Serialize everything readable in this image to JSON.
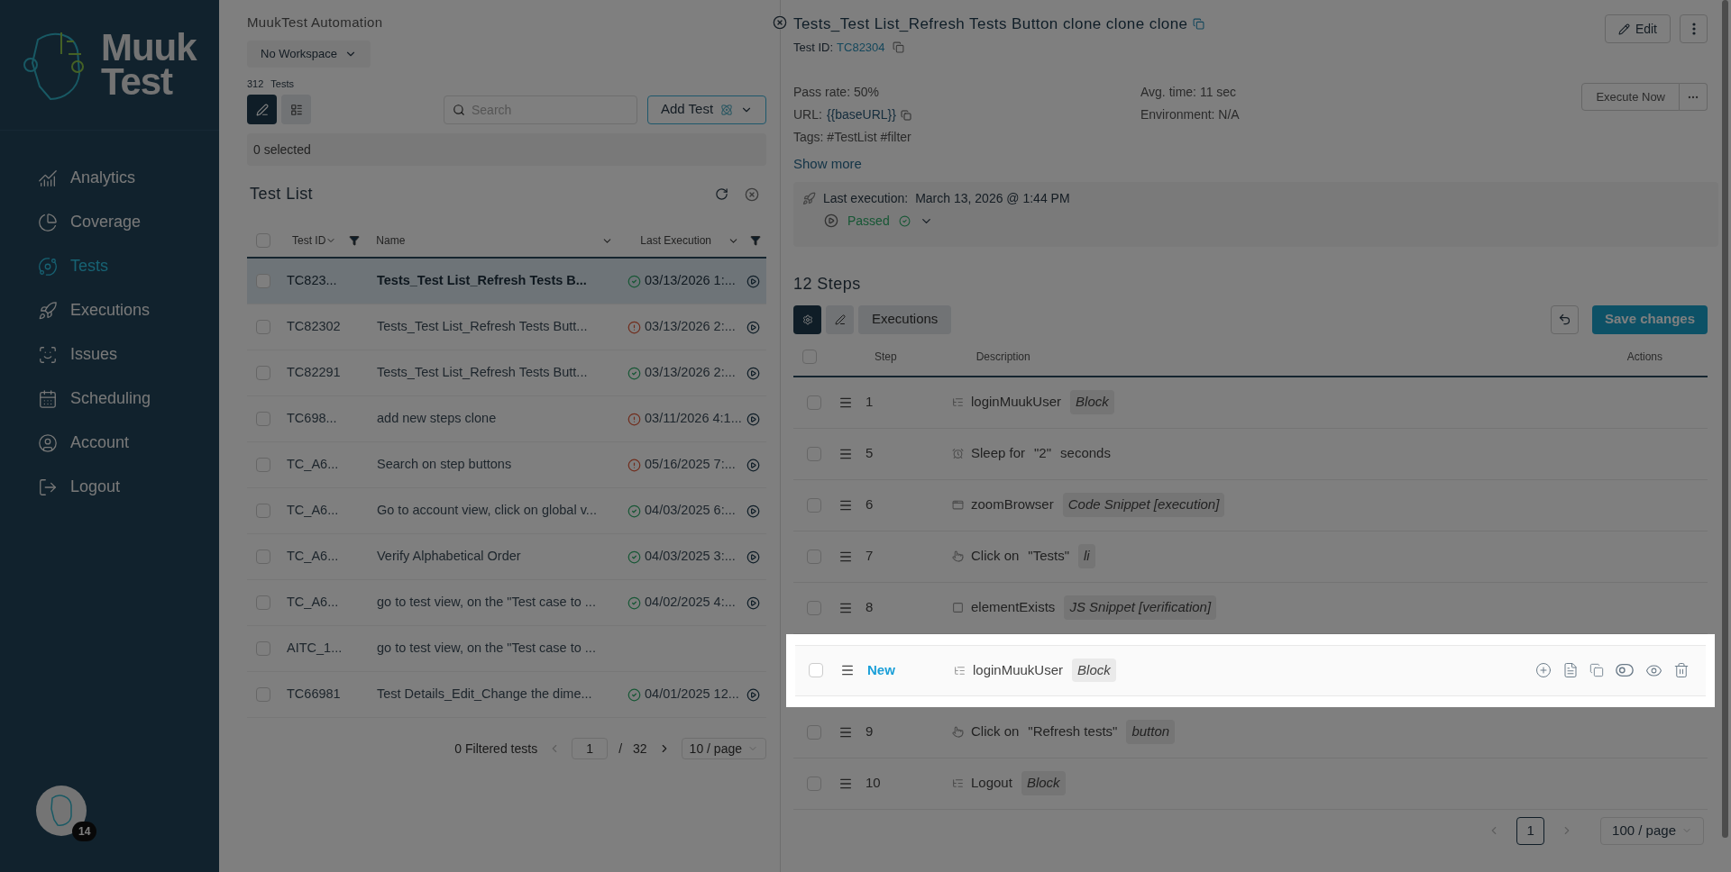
{
  "sidebar": {
    "logo": {
      "line1": "Muuk",
      "line2": "Test"
    },
    "items": [
      {
        "kind": "analytics",
        "label": "Analytics",
        "selected": false
      },
      {
        "kind": "coverage",
        "label": "Coverage",
        "selected": false
      },
      {
        "kind": "tests",
        "label": "Tests",
        "selected": true
      },
      {
        "kind": "executions",
        "label": "Executions",
        "selected": false
      },
      {
        "kind": "issues",
        "label": "Issues",
        "selected": false
      },
      {
        "kind": "scheduling",
        "label": "Scheduling",
        "selected": false
      },
      {
        "kind": "account",
        "label": "Account",
        "selected": false
      },
      {
        "kind": "logout",
        "label": "Logout",
        "selected": false
      }
    ],
    "avatar_badge": "14"
  },
  "workspace": {
    "organization": "MuukTest Automation",
    "workspace": "No Workspace"
  },
  "tests": {
    "count": "312",
    "count_label": "Tests",
    "views": [
      {
        "kind": "edit",
        "selected": true
      },
      {
        "kind": "list",
        "selected": false
      }
    ],
    "search_placeholder": "Search",
    "add_button": "Add Test",
    "selected_count": "0 selected",
    "list_title": "Test List",
    "all_checked": false,
    "columns": [
      "Test ID",
      "Name",
      "Last Execution"
    ],
    "rows": [
      {
        "id": "TC823...",
        "name": "Tests_Test List_Refresh Tests B...",
        "kind": "passed",
        "last_execution": "03/13/2026 1:...",
        "selected": true,
        "checked": false
      },
      {
        "id": "TC82302",
        "name": "Tests_Test List_Refresh Tests Butt...",
        "kind": "failed",
        "last_execution": "03/13/2026 2:...",
        "selected": false,
        "checked": false
      },
      {
        "id": "TC82291",
        "name": "Tests_Test List_Refresh Tests Butt...",
        "kind": "passed",
        "last_execution": "03/13/2026 2:...",
        "selected": false,
        "checked": false
      },
      {
        "id": "TC698...",
        "name": "add new steps clone",
        "kind": "failed",
        "last_execution": "03/11/2026 4:1...",
        "selected": false,
        "checked": false
      },
      {
        "id": "TC_A6...",
        "name": "Search on step buttons",
        "kind": "failed",
        "last_execution": "05/16/2025 7:...",
        "selected": false,
        "checked": false
      },
      {
        "id": "TC_A6...",
        "name": "Go to account view, click on global v...",
        "kind": "passed",
        "last_execution": "04/03/2025 6:...",
        "selected": false,
        "checked": false
      },
      {
        "id": "TC_A6...",
        "name": "Verify Alphabetical Order",
        "kind": "passed",
        "last_execution": "04/03/2025 3:...",
        "selected": false,
        "checked": false
      },
      {
        "id": "TC_A6...",
        "name": "go to test view, on the \"Test case to ...",
        "kind": "passed",
        "last_execution": "04/02/2025 4:...",
        "selected": false,
        "checked": false
      },
      {
        "id": "AITC_1...",
        "name": "go to test view, on the \"Test case to ...",
        "kind": "unrun",
        "selected": false,
        "checked": false
      },
      {
        "id": "TC66981",
        "name": "Test Details_Edit_Change the dime...",
        "kind": "passed",
        "last_execution": "04/01/2025 12...",
        "selected": false,
        "checked": false
      }
    ],
    "footer": {
      "filtered": "0 Filtered tests",
      "page": "1",
      "separator": "/",
      "pages": "32",
      "page_size": "10 / page"
    }
  },
  "detail": {
    "title": "Tests_Test List_Refresh Tests Button clone clone clone",
    "test_id_label": "Test ID:",
    "test_id": "TC82304",
    "edit_button": "Edit",
    "pass_rate": "Pass rate: 50%",
    "url_label": "URL:",
    "url": "{{baseURL}}",
    "tags": "Tags: #TestList #filter",
    "avg_time": "Avg. time: 11 sec",
    "environment": "Environment: N/A",
    "execute_button": "Execute Now",
    "show_more": "Show more",
    "last_execution_label": "Last execution:",
    "last_execution": "March 13, 2026 @ 1:44 PM",
    "result": "Passed",
    "steps_title": "12 Steps",
    "tabs": [
      {
        "kind": "run",
        "selected": true
      },
      {
        "kind": "edit",
        "selected": false
      },
      {
        "kind": "text",
        "label": "Executions",
        "selected": false
      }
    ],
    "save_button": "Save changes",
    "all_checked": false,
    "step_columns": [
      "Step",
      "Description",
      "Actions"
    ],
    "steps": [
      {
        "kind": "block",
        "number": "1",
        "texts": [
          "loginMuukUser"
        ],
        "tag": "Block",
        "highlighted": false,
        "checked": false
      },
      {
        "kind": "sleep",
        "number": "5",
        "texts": [
          "Sleep for",
          "\"2\"",
          "seconds"
        ],
        "highlighted": false,
        "checked": false
      },
      {
        "kind": "code",
        "number": "6",
        "texts": [
          "zoomBrowser"
        ],
        "tag": "Code Snippet [execution]",
        "highlighted": false,
        "checked": false
      },
      {
        "kind": "click",
        "number": "7",
        "texts": [
          "Click on",
          "\"Tests\""
        ],
        "tag": "li",
        "highlighted": false,
        "checked": false
      },
      {
        "kind": "check",
        "number": "8",
        "texts": [
          "elementExists"
        ],
        "tag": "JS Snippet [verification]",
        "highlighted": false,
        "checked": false
      },
      {
        "kind": "block",
        "number": "New",
        "texts": [
          "loginMuukUser"
        ],
        "tag": "Block",
        "highlighted": true,
        "checked": false
      },
      {
        "kind": "click",
        "number": "9",
        "texts": [
          "Click on",
          "\"Refresh tests\""
        ],
        "tag": "button",
        "highlighted": false,
        "checked": false
      },
      {
        "kind": "block",
        "number": "10",
        "texts": [
          "Logout"
        ],
        "tag": "Block",
        "highlighted": false,
        "checked": false
      }
    ],
    "pagination": {
      "page": "1",
      "page_size": "100 / page"
    }
  }
}
